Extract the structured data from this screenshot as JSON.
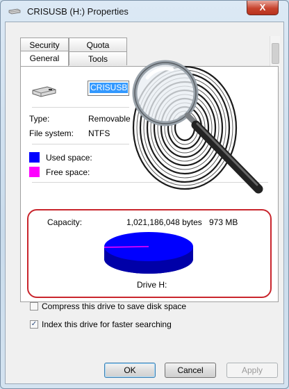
{
  "window": {
    "title": "CRISUSB (H:) Properties",
    "close_glyph": "X"
  },
  "tabs": [
    {
      "label": "Security"
    },
    {
      "label": "Quota"
    },
    {
      "label": "General"
    },
    {
      "label": "Tools"
    }
  ],
  "general": {
    "drive_name": "CRISUSB",
    "type_label": "Type:",
    "type_value": "Removable",
    "fs_label": "File system:",
    "fs_value": "NTFS",
    "used_label": "Used space:",
    "free_label": "Free space:",
    "capacity_label": "Capacity:",
    "capacity_bytes": "1,021,186,048 bytes",
    "capacity_size": "973 MB",
    "drive_label": "Drive H:",
    "used_color": "#0000ff",
    "free_color": "#ff00ff"
  },
  "options": {
    "compress_label": "Compress this drive to save disk space",
    "compress_checked": false,
    "index_label": "Index this drive for faster searching",
    "index_checked": true,
    "check_glyph": "✓"
  },
  "buttons": {
    "ok": "OK",
    "cancel": "Cancel",
    "apply": "Apply"
  },
  "icons": {
    "title": "usb-drive-icon",
    "drive": "usb-drive-icon",
    "overlay": "fingerprint-magnifier-icon"
  }
}
